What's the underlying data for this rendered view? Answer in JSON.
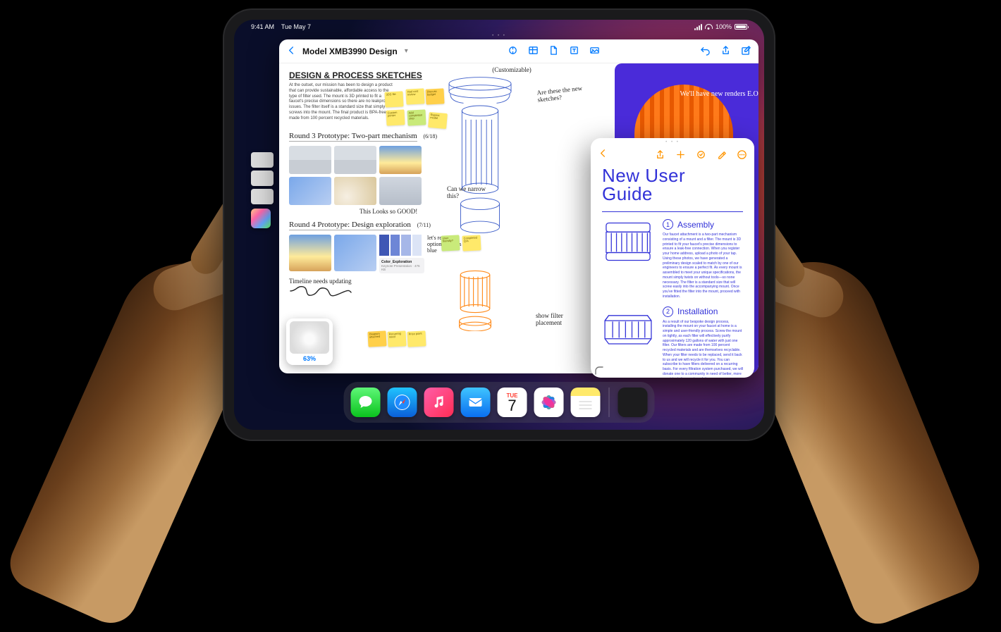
{
  "status": {
    "time": "9:41 AM",
    "date": "Tue May 7",
    "battery_pct": "100%"
  },
  "notes": {
    "doc_title": "Model XMB3990 Design",
    "section_header": "DESIGN & PROCESS SKETCHES",
    "intro": "At the outset, our mission has been to design a product that can provide sustainable, affordable access to the type of filter used. The mount is 3D printed to fit a faucet's precise dimensions so there are no leakproof issues. The filter itself is a standard size that simply screws into the mount. The final product is BPA-free and made from 100 percent recycled materials.",
    "round3_head": "Round 3 Prototype: Two-part mechanism",
    "round3_date": "(6/18)",
    "caption_good": "This Looks so GOOD!",
    "round4_head": "Round 4 Prototype: Design exploration",
    "round4_date": "(7/11)",
    "file_name": "Color_Exploration",
    "file_meta": "Keynote Presentation · 476 KB",
    "timeline_note": "Timeline needs updating",
    "custom_label": "(Customizable)",
    "ask_new": "Are these the new sketches?",
    "ask_narrow": "Can we narrow this?",
    "review_note": "let's review options for this blue",
    "filter_note": "show filter placement",
    "stickies": {
      "a": "3DS file",
      "b": "Had cost review",
      "c": "Discuss budget",
      "d": "Custom printer",
      "e": "Add completion step",
      "f": "Reprint model",
      "g": "User friendly?",
      "h": "Completed Q/A",
      "i": "Diagram attached",
      "j": "Recurring need",
      "k": "Price point"
    },
    "poster_note": "We'll have new renders E.O.D."
  },
  "upload": {
    "pct": "63%"
  },
  "slideover": {
    "title_l1": "New User",
    "title_l2": "Guide",
    "s1_title": "Assembly",
    "s1_body": "Our faucet attachment is a two-part mechanism consisting of a mount and a filter. The mount is 3D printed to fit your faucet's precise dimensions to ensure a leak-free connection. When you register your home address, upload a photo of your tap. Using these photos, we have generated a preliminary design scaled to match by one of our engineers to ensure a perfect fit. As every mount is assembled to meet your unique specifications, the mount simply twists on without tools—so none necessary. The filter is a standard size that will screw easily into the accompanying mount. Once you've fitted the filter into the mount, proceed with installation.",
    "s2_title": "Installation",
    "s2_body": "As a result of our bespoke design process, installing the mount on your faucet at home is a simple and user-friendly process. Screw the mount on tightly, as each filter will effectively purify approximately 120 gallons of water with just one filter. Our filters are made from 100 percent recycled materials and are themselves recyclable. When your filter needs to be replaced, send it back to us and we will recycle it for you. You can subscribe to have filters delivered on a recurring basis. For every filtration system purchased, we will donate one to a community in need of better, more consistent clean water solutions."
  },
  "dock": {
    "calendar_dow": "TUE",
    "calendar_day": "7"
  }
}
